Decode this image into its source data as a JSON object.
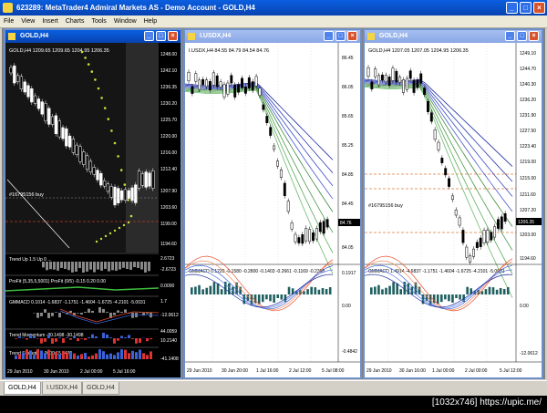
{
  "app": {
    "title": "623289: MetaTrader4 Admiral Markets AS - Demo Account - GOLD,H4",
    "menu": [
      "File",
      "View",
      "Insert",
      "Charts",
      "Tools",
      "Window",
      "Help"
    ]
  },
  "windows": [
    {
      "title": "GOLD,H4",
      "header": "GOLD,H4  1209.65 1209.65 1204.95 1206.35",
      "prices": [
        "1248.00",
        "1242.10",
        "1236.35",
        "1230.20",
        "1225.70",
        "1220.00",
        "1216.00",
        "1212.40",
        "1207.90",
        "1203.60",
        "1199.00",
        "1194.60",
        "2.6723",
        "-2.6723",
        "0.0000",
        "1.7",
        "-12.0612",
        "44.0059",
        "10.2140",
        "-41.1408"
      ],
      "order_label": "#16795156 buy",
      "indicators": [
        "Trend Up 1.5 Up 0 ...",
        "ProFit (5,35,5,5001) ProFit (0/5) -0.15 0.20 0.00",
        "GMMACD 0.1014 -1.6837 -1.1751 -1.4604 -1.6725 -4.2101 -5.0031",
        "Trend Momentum -30.1498 -30.1498",
        "Trend Strength 0.0000 15.6476"
      ],
      "time_labels": [
        "29 Jun 2010",
        "30 Jun 2010",
        "2 Jul 00:00",
        "5 Jul 16:00"
      ]
    },
    {
      "title": "I.USDX,H4",
      "header": "I.USDX,H4  84.55 84.79 84.54 84.76",
      "prices": [
        "86.45",
        "86.05",
        "85.65",
        "85.25",
        "84.85",
        "84.45",
        "84.05",
        "0.1917",
        "0.00",
        "-0.4842"
      ],
      "current_price": "84.76",
      "indicator": "GMMACD 0.1220 -0.1580 -0.2800 -0.1403 -0.2661 -0.1169 -0.2368",
      "time_labels": [
        "29 Jun 2010",
        "30 Jun 20:00",
        "1 Jul 16:00",
        "2 Jul 12:00",
        "5 Jul 08:00"
      ]
    },
    {
      "title": "GOLD,H4",
      "header": "GOLD,H4  1207.05 1207.05 1204.95 1206.35",
      "prices": [
        "1249.10",
        "1244.70",
        "1240.30",
        "1236.20",
        "1231.90",
        "1227.50",
        "1223.40",
        "1219.00",
        "1215.00",
        "1211.60",
        "1207.20",
        "1203.00",
        "1194.60",
        "0.00",
        "-12.0612"
      ],
      "current_price": "1206.35",
      "order_label": "#16795156 buy",
      "indicator": "GMMACD 1.4914 -4.6837 -1.1751 -1.4604 -1.6725 -4.2101 -5.0031",
      "time_labels": [
        "29 Jun 2010",
        "30 Jun 16:00",
        "1 Jul 00:00",
        "2 Jul 00:00",
        "5 Jul 12:00"
      ]
    }
  ],
  "tabs": [
    "GOLD,H4",
    "I.USDX,H4",
    "GOLD,H4"
  ],
  "watermark": "[1032x746] https://upic.me/"
}
